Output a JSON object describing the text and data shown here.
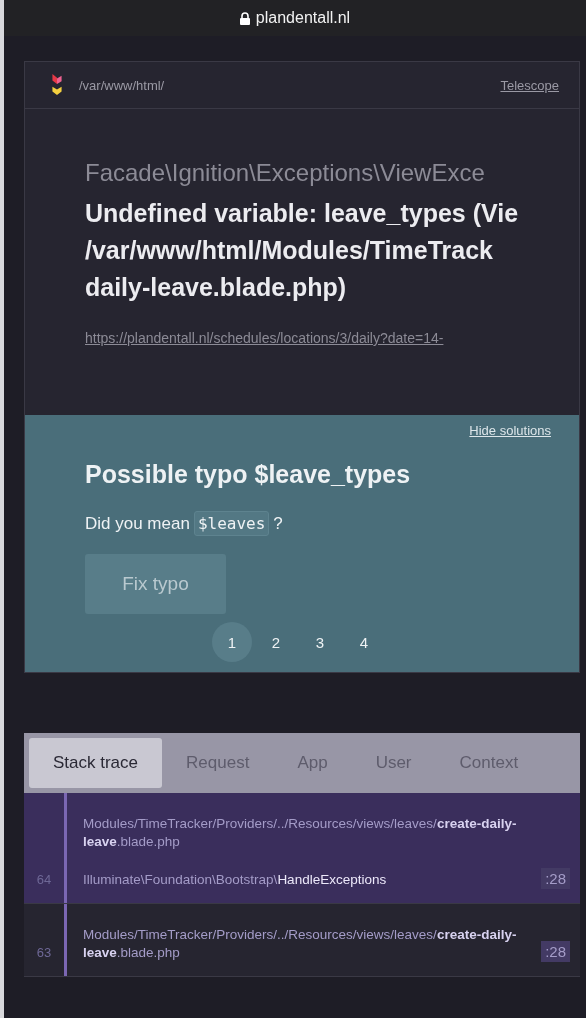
{
  "browser": {
    "address": "plandentall.nl"
  },
  "header": {
    "path": "/var/www/html/",
    "link": "Telescope"
  },
  "exception": {
    "class": "Facade\\Ignition\\Exceptions\\ViewExce",
    "message_lines": [
      "Undefined variable: leave_types (Vie",
      "/var/www/html/Modules/TimeTrack",
      "daily-leave.blade.php)"
    ],
    "url": "https://plandentall.nl/schedules/locations/3/daily?date=14-"
  },
  "solutions": {
    "hide_link": "Hide solutions",
    "title": "Possible typo $leave_types",
    "text_before": "Did you mean",
    "code": "$leaves",
    "text_after": "?",
    "button": "Fix typo",
    "pages": [
      {
        "label": "1",
        "selected": true
      },
      {
        "label": "2",
        "selected": false
      },
      {
        "label": "3",
        "selected": false
      },
      {
        "label": "4",
        "selected": false
      }
    ]
  },
  "tabs": [
    {
      "label": "Stack trace",
      "selected": true
    },
    {
      "label": "Request",
      "selected": false
    },
    {
      "label": "App",
      "selected": false
    },
    {
      "label": "User",
      "selected": false
    },
    {
      "label": "Context",
      "selected": false
    }
  ],
  "frames": [
    {
      "number": "64",
      "selected": true,
      "file": "Modules/TimeTracker/Providers/../Resources/views/leaves/**create-daily-leave**.blade.php",
      "class": "Illuminate\\Foundation\\Bootstrap\\**HandleExceptions**",
      "line": ":28"
    },
    {
      "number": "63",
      "selected": false,
      "file": "Modules/TimeTracker/Providers/../Resources/views/leaves/**create-daily-leave**.blade.php",
      "line": ":28"
    }
  ]
}
